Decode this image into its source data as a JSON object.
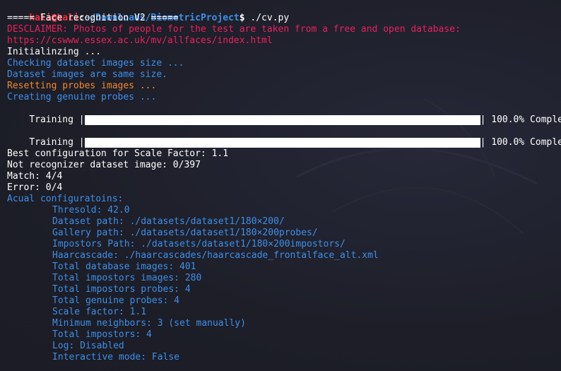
{
  "prompt": {
    "user": "kali@kali",
    "separator": ":",
    "path": "~/Downloads/BiometricProject",
    "sign": "$",
    "command": " ./cv.py"
  },
  "header": "===== Face recognition V2 =====",
  "disclaimer": "DESCLAIMER: Photos of people for the test are taken from a free and open database:",
  "disclaimer_url": "https://cswww.essex.ac.uk/mv/allfaces/index.html",
  "init_lines": {
    "initializing": "Initialinzing ...",
    "checking": "Checking dataset images size ...",
    "same_size": "Dataset images are same size.",
    "resetting": "Resetting probes images ...",
    "creating": "Creating genuine probes ..."
  },
  "progress_bars": [
    {
      "label": "Training",
      "progress": 1.0,
      "percent_text": "100.0%",
      "status": "Complete"
    },
    {
      "label": "Training",
      "progress": 1.0,
      "percent_text": "100.0%",
      "status": "Complete"
    }
  ],
  "results": {
    "best_config": "Best configuration for Scale Factor: 1.1",
    "not_recognized": "Not recognizer dataset image: 0/397",
    "match": "Match: 4/4",
    "error": "Error: 0/4"
  },
  "config_title": "Acual configuratoins:",
  "config_items": [
    "Thresold: 42.0",
    "Dataset path: ./datasets/dataset1/180×200/",
    "Gallery path: ./datasets/dataset1/180×200probes/",
    "Impostors Path: ./datasets/dataset1/180×200impostors/",
    "Haarcascade: ./haarcascades/haarcascade_frontalface_alt.xml",
    "Total database images: 401",
    "Total impostors images: 280",
    "Total impostors probes: 4",
    "Total genuine probes: 4",
    "Scale factor: 1.1",
    "Minimum neighbors: 3 (set manually)",
    "Total impostors: 4",
    "Log: Disabled",
    "Interactive mode: False"
  ],
  "colors": {
    "background": "#1e1f29",
    "prompt_user": "#ff2a3c",
    "path_blue": "#3d8fe8",
    "disclaimer_red": "#e8205e",
    "warning_orange": "#f08a2c",
    "text_white": "#ffffff"
  }
}
